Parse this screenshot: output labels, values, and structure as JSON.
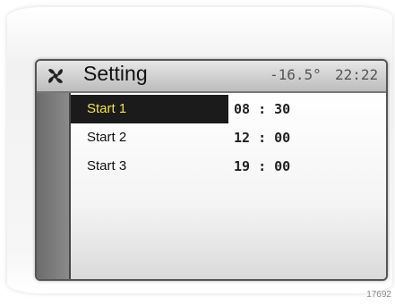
{
  "header": {
    "title": "Setting",
    "temperature": "-16.5°",
    "time": "22:22",
    "icon": "fan-icon"
  },
  "rows": [
    {
      "label": "Start 1",
      "time": "08 : 30",
      "selected": true
    },
    {
      "label": "Start 2",
      "time": "12 : 00",
      "selected": false
    },
    {
      "label": "Start 3",
      "time": "19 : 00",
      "selected": false
    }
  ],
  "colors": {
    "selected_bg": "#1b1b1b",
    "selected_text": "#f3e33a"
  },
  "reference_code": "17692"
}
